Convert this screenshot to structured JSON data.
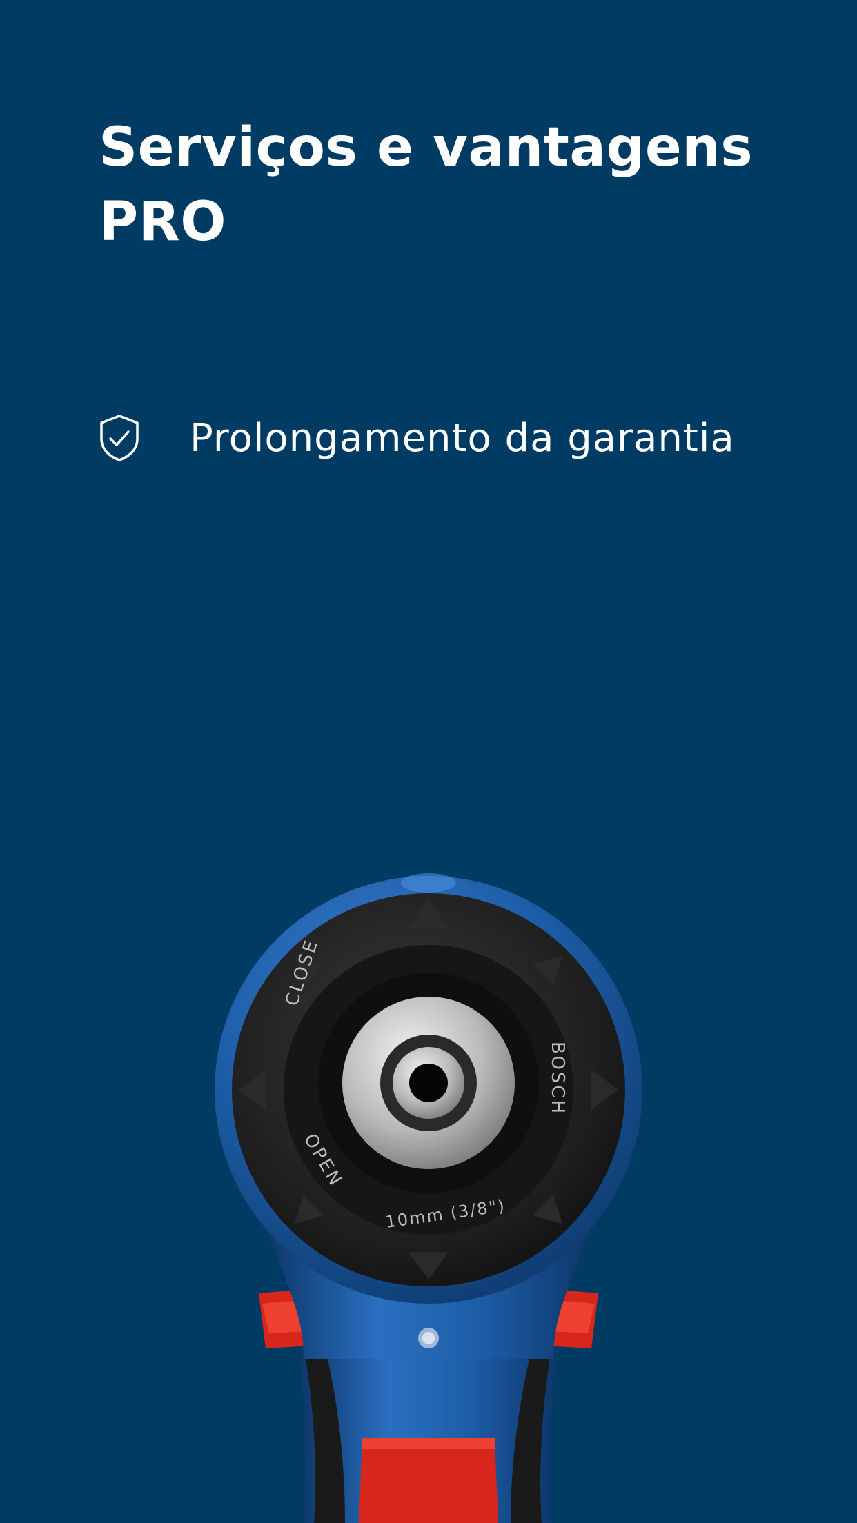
{
  "screen": {
    "title": "Serviços e vantagens PRO"
  },
  "benefits": [
    {
      "label": "Prolongamento da garantia",
      "icon": "shield-check-icon"
    }
  ],
  "product_image": {
    "chuck_text_top_left": "CLOSE",
    "chuck_text_bottom_left": "OPEN",
    "chuck_text_bottom": "10mm (3/8\")",
    "chuck_text_right": "BOSCH"
  },
  "colors": {
    "background": "#003b63",
    "text": "#ffffff",
    "drill_blue": "#1d5ea8",
    "drill_red": "#d8261c"
  }
}
